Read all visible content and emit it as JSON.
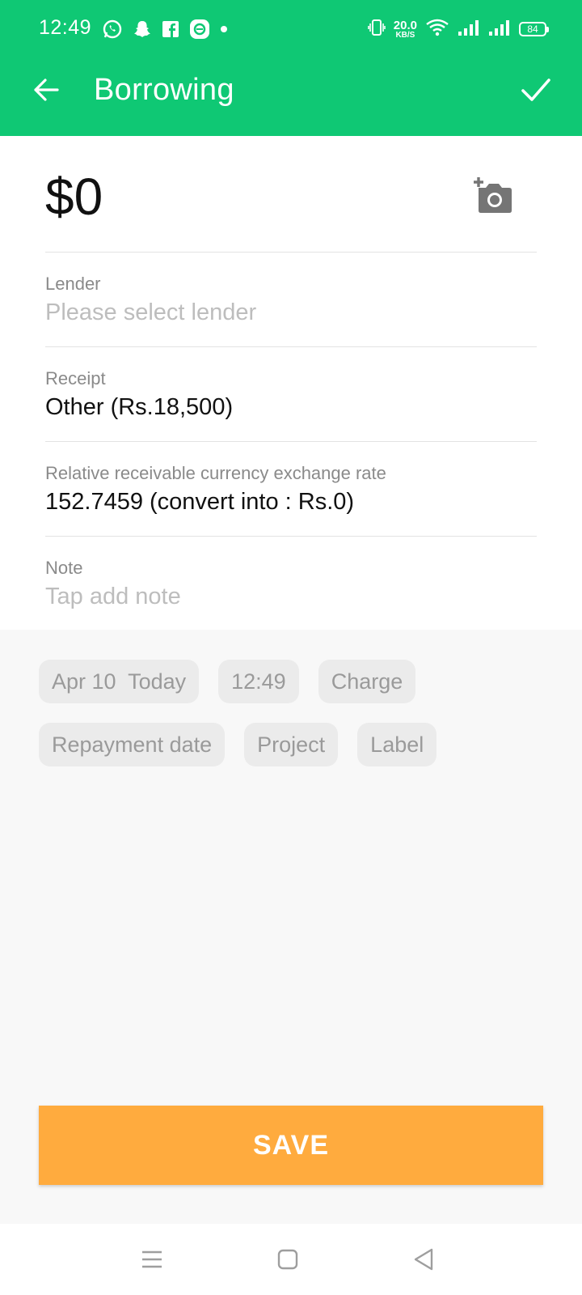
{
  "status_bar": {
    "time": "12:49",
    "net_speed_value": "20.0",
    "net_speed_unit": "KB/S",
    "battery": "84",
    "left_icons": [
      "whatsapp-icon",
      "snapchat-icon",
      "facebook-icon",
      "messenger-icon",
      "dot-icon"
    ],
    "right_icons": [
      "vibrate-icon",
      "wifi-icon",
      "signal-icon",
      "signal-icon",
      "battery-icon"
    ]
  },
  "app_bar": {
    "title": "Borrowing",
    "back_icon": "arrow-left-icon",
    "confirm_icon": "checkmark-icon",
    "background": "#0fc874"
  },
  "amount": {
    "value": "$0",
    "camera_icon": "add-photo-icon"
  },
  "fields": {
    "lender": {
      "label": "Lender",
      "placeholder": "Please select lender"
    },
    "receipt": {
      "label": "Receipt",
      "value": "Other (Rs.18,500)"
    },
    "exchange_rate": {
      "label": "Relative receivable currency exchange rate",
      "value": "152.7459 (convert into : Rs.0)"
    },
    "note": {
      "label": "Note",
      "placeholder": "Tap add note"
    }
  },
  "chips": {
    "row1": [
      "Apr 10  Today",
      "12:49",
      "Charge"
    ],
    "row2": [
      "Repayment date",
      "Project",
      "Label"
    ]
  },
  "save_button": {
    "label": "SAVE",
    "color": "#ffab3e"
  },
  "nav_bar": {
    "buttons": [
      "menu-icon",
      "home-square-icon",
      "back-triangle-icon"
    ]
  }
}
